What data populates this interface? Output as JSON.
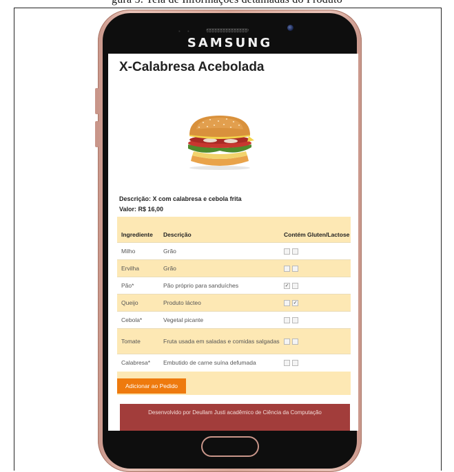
{
  "document": {
    "caption_fragment": "gura 5: Tela de Informações detalhadas do Produto"
  },
  "device": {
    "brand": "SAMSUNG"
  },
  "product": {
    "title": "X-Calabresa Acebolada",
    "description": "Descrição: X com calabresa e cebola frita",
    "price": "Valor: R$ 16,00"
  },
  "table": {
    "headers": [
      "Ingrediente",
      "Descrição",
      "Contém Gluten/Lactose"
    ],
    "rows": [
      {
        "ingredient": "Milho",
        "description": "Grão",
        "gluten": false,
        "lactose": false
      },
      {
        "ingredient": "Ervilha",
        "description": "Grão",
        "gluten": false,
        "lactose": false
      },
      {
        "ingredient": "Pão*",
        "description": "Pão próprio para sanduíches",
        "gluten": true,
        "lactose": false
      },
      {
        "ingredient": "Queijo",
        "description": "Produto lácteo",
        "gluten": false,
        "lactose": true
      },
      {
        "ingredient": "Cebola*",
        "description": "Vegetal picante",
        "gluten": false,
        "lactose": false
      },
      {
        "ingredient": "Tomate",
        "description": "Fruta usada em saladas e comidas salgadas",
        "gluten": false,
        "lactose": false
      },
      {
        "ingredient": "Calabresa*",
        "description": "Embutido de carne suína defumada",
        "gluten": false,
        "lactose": false
      }
    ]
  },
  "actions": {
    "add_to_order": "Adicionar ao Pedido"
  },
  "footer": {
    "text": "Desenvolvido por Deullam Justi acadêmico de Ciência da Computação"
  },
  "colors": {
    "card_bg": "#fde8b4",
    "button": "#ee7a0e",
    "footer_bg": "#a23d3b",
    "phone_frame": "#d9a899"
  }
}
